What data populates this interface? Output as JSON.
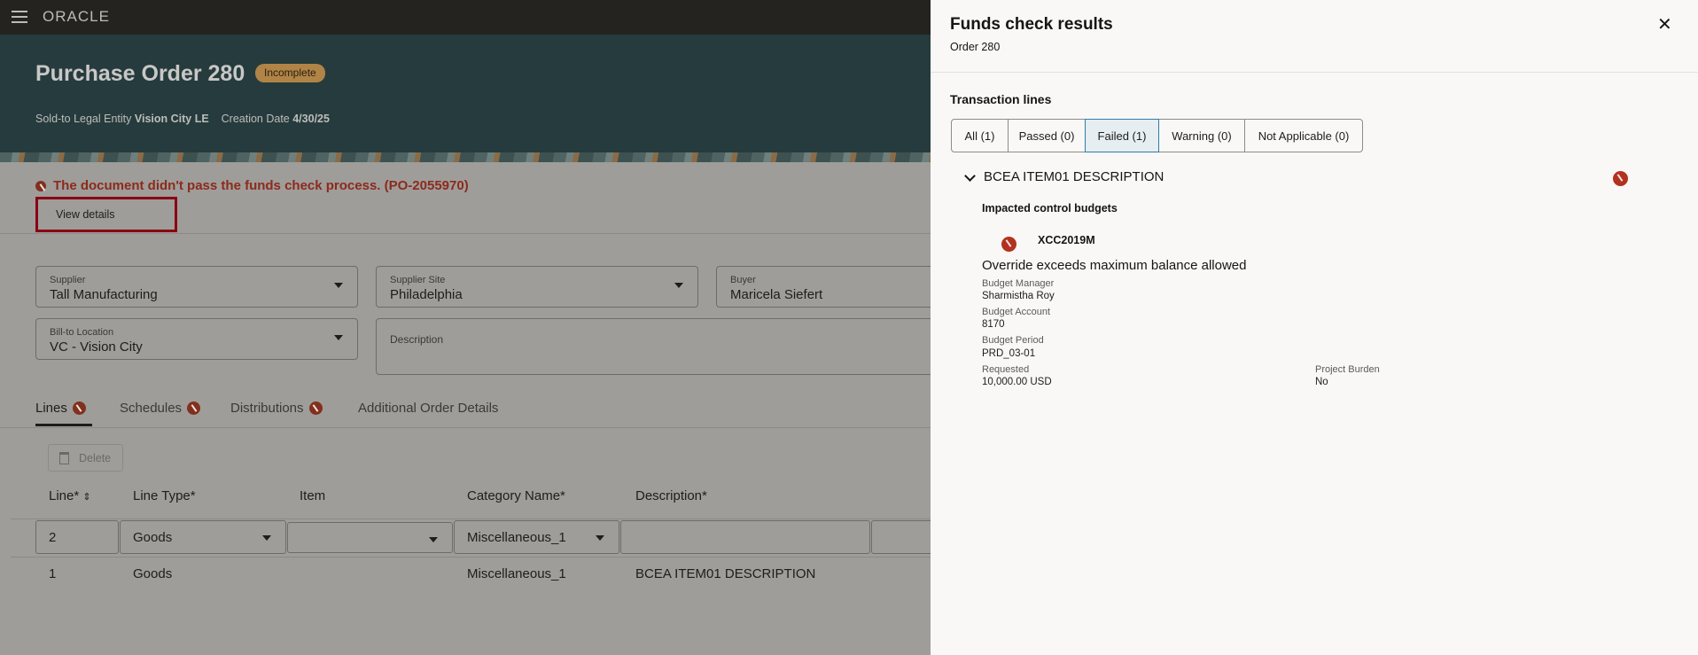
{
  "app": {
    "logo": "ORACLE",
    "menu_icon": "hamburger-icon"
  },
  "header": {
    "title": "Purchase Order 280",
    "status": "Incomplete",
    "sold_to_label": "Sold-to Legal Entity",
    "sold_to_value": "Vision City LE",
    "creation_label": "Creation Date",
    "creation_value": "4/30/25"
  },
  "alert": {
    "message": "The document didn't pass the funds check process. (PO-2055970)",
    "view_details": "View details"
  },
  "fields": {
    "supplier": {
      "label": "Supplier",
      "value": "Tall Manufacturing"
    },
    "supplier_site": {
      "label": "Supplier Site",
      "value": "Philadelphia"
    },
    "buyer": {
      "label": "Buyer",
      "value": "Maricela Siefert"
    },
    "bill_to": {
      "label": "Bill-to Location",
      "value": "VC - Vision City"
    },
    "description": {
      "label": "Description",
      "value": ""
    }
  },
  "tabs": [
    {
      "label": "Lines"
    },
    {
      "label": "Schedules"
    },
    {
      "label": "Distributions"
    },
    {
      "label": "Additional Order Details"
    }
  ],
  "lines": {
    "delete_label": "Delete",
    "columns": [
      "Line*",
      "Line Type*",
      "Item",
      "Category Name*",
      "Description*"
    ],
    "edit_row": {
      "line": "2",
      "line_type": "Goods",
      "item": "",
      "category": "Miscellaneous_1",
      "description": ""
    },
    "rows": [
      {
        "line": "1",
        "line_type": "Goods",
        "item": "",
        "category": "Miscellaneous_1",
        "description": "BCEA ITEM01 DESCRIPTION"
      }
    ]
  },
  "panel": {
    "title": "Funds check results",
    "subtitle": "Order 280",
    "section": "Transaction lines",
    "filters": [
      {
        "label": "All (1)"
      },
      {
        "label": "Passed (0)"
      },
      {
        "label": "Failed (1)",
        "selected": true
      },
      {
        "label": "Warning (0)"
      },
      {
        "label": "Not Applicable (0)"
      }
    ],
    "line": {
      "title": "BCEA ITEM01 DESCRIPTION",
      "impacted": "Impacted control budgets",
      "budget": {
        "code": "XCC2019M",
        "message": "Override exceeds maximum balance allowed",
        "manager_label": "Budget Manager",
        "manager": "Sharmistha Roy",
        "account_label": "Budget Account",
        "account": "8170",
        "period_label": "Budget Period",
        "period": "PRD_03-01",
        "requested_label": "Requested",
        "requested": "10,000.00 USD",
        "burden_label": "Project Burden",
        "burden": "No"
      }
    }
  },
  "colors": {
    "error": "#b3321f",
    "selected_filter": "#e6eef2",
    "selected_border": "#2d7ea8"
  }
}
